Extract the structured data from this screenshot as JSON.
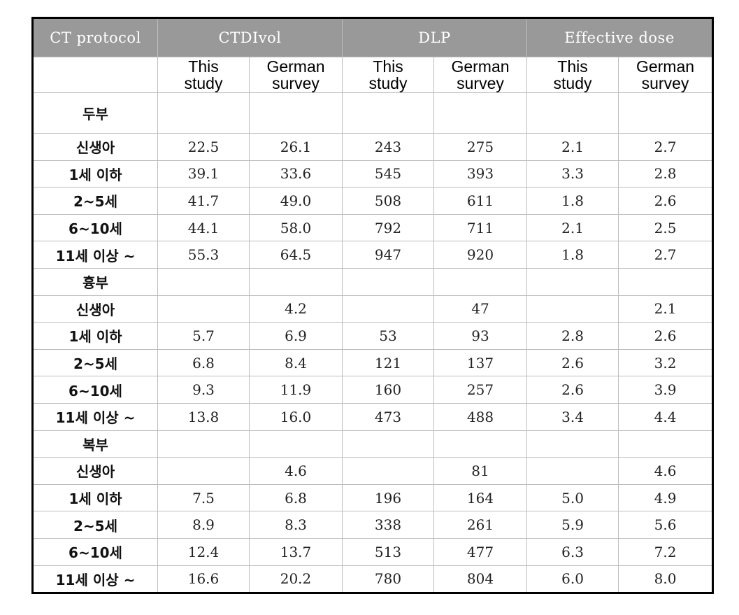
{
  "table": {
    "header": {
      "protocol_label": "CT protocol",
      "groups": [
        {
          "label": "CTDIvol"
        },
        {
          "label": "DLP"
        },
        {
          "label": "Effective dose"
        }
      ],
      "subcolumns": [
        {
          "line1": "This",
          "line2": "study"
        },
        {
          "line1": "German",
          "line2": "survey"
        },
        {
          "line1": "This",
          "line2": "study"
        },
        {
          "line1": "German",
          "line2": "survey"
        },
        {
          "line1": "This",
          "line2": "study"
        },
        {
          "line1": "German",
          "line2": "survey"
        }
      ]
    },
    "sections": [
      {
        "name": "두부",
        "rows": [
          {
            "label": "신생아",
            "values": [
              "22.5",
              "26.1",
              "243",
              "275",
              "2.1",
              "2.7"
            ]
          },
          {
            "label": "1세 이하",
            "values": [
              "39.1",
              "33.6",
              "545",
              "393",
              "3.3",
              "2.8"
            ]
          },
          {
            "label": "2~5세",
            "values": [
              "41.7",
              "49.0",
              "508",
              "611",
              "1.8",
              "2.6"
            ]
          },
          {
            "label": "6~10세",
            "values": [
              "44.1",
              "58.0",
              "792",
              "711",
              "2.1",
              "2.5"
            ]
          },
          {
            "label": "11세 이상 ~",
            "values": [
              "55.3",
              "64.5",
              "947",
              "920",
              "1.8",
              "2.7"
            ]
          }
        ]
      },
      {
        "name": "흉부",
        "rows": [
          {
            "label": "신생아",
            "values": [
              "",
              "4.2",
              "",
              "47",
              "",
              "2.1"
            ]
          },
          {
            "label": "1세 이하",
            "values": [
              "5.7",
              "6.9",
              "53",
              "93",
              "2.8",
              "2.6"
            ]
          },
          {
            "label": "2~5세",
            "values": [
              "6.8",
              "8.4",
              "121",
              "137",
              "2.6",
              "3.2"
            ]
          },
          {
            "label": "6~10세",
            "values": [
              "9.3",
              "11.9",
              "160",
              "257",
              "2.6",
              "3.9"
            ]
          },
          {
            "label": "11세 이상 ~",
            "values": [
              "13.8",
              "16.0",
              "473",
              "488",
              "3.4",
              "4.4"
            ]
          }
        ]
      },
      {
        "name": "복부",
        "rows": [
          {
            "label": "신생아",
            "values": [
              "",
              "4.6",
              "",
              "81",
              "",
              "4.6"
            ]
          },
          {
            "label": "1세 이하",
            "values": [
              "7.5",
              "6.8",
              "196",
              "164",
              "5.0",
              "4.9"
            ]
          },
          {
            "label": "2~5세",
            "values": [
              "8.9",
              "8.3",
              "338",
              "261",
              "5.9",
              "5.6"
            ]
          },
          {
            "label": "6~10세",
            "values": [
              "12.4",
              "13.7",
              "513",
              "477",
              "6.3",
              "7.2"
            ]
          },
          {
            "label": "11세 이상 ~",
            "values": [
              "16.6",
              "20.2",
              "780",
              "804",
              "6.0",
              "8.0"
            ]
          }
        ]
      }
    ]
  }
}
